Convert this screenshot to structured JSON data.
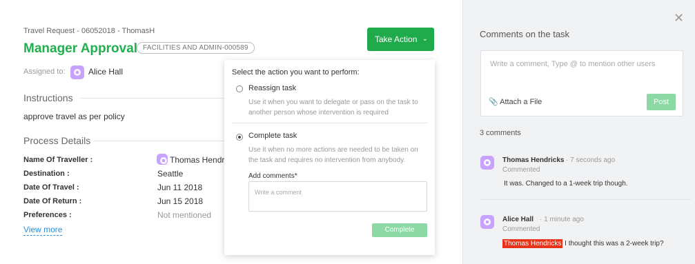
{
  "task": {
    "breadcrumb": "Travel Request - 06052018 - ThomasH",
    "title": "Manager Approval",
    "reference": "FACILITIES AND ADMIN-000589",
    "take_action_label": "Take Action",
    "assigned_label": "Assigned to:",
    "assignee": "Alice Hall"
  },
  "instructions": {
    "heading": "Instructions",
    "text": "approve travel as per policy"
  },
  "process_details": {
    "heading": "Process Details",
    "rows": [
      {
        "label": "Name Of Traveller :",
        "value": "Thomas Hendr"
      },
      {
        "label": "Destination :",
        "value": "Seattle"
      },
      {
        "label": "Date Of Travel :",
        "value": "Jun 11 2018"
      },
      {
        "label": "Date Of Return :",
        "value": "Jun 15 2018"
      },
      {
        "label": "Preferences :",
        "value": "Not mentioned"
      }
    ],
    "view_more": "View more"
  },
  "action_panel": {
    "title": "Select the action you want to perform:",
    "options": [
      {
        "label": "Reassign task",
        "description": "Use it when you want to delegate or pass on the task to another person whose intervention is required",
        "selected": false
      },
      {
        "label": "Complete task",
        "description": "Use it when no more actions are needed to be taken on the task and requires no intervention from anybody.",
        "selected": true
      }
    ],
    "comments_label": "Add comments*",
    "comments_placeholder": "Write a comment",
    "complete_label": "Complete"
  },
  "comments_panel": {
    "title": "Comments on the task",
    "input_placeholder": "Write a comment, Type @ to mention other users",
    "attach_label": "Attach a File",
    "post_label": "Post",
    "count_label": "3 comments",
    "comments": [
      {
        "author": "Thomas Hendricks",
        "time": "7 seconds ago",
        "action": "Commented",
        "mention": "",
        "text": "It was. Changed to a 1-week trip though."
      },
      {
        "author": "Alice Hall",
        "time": "1 minute ago",
        "action": "Commented",
        "mention": "Thomas Hendricks",
        "text": "I thought this was a 2-week trip?"
      }
    ]
  },
  "colors": {
    "accent_green": "#1faa4b",
    "title_green": "#22b04e",
    "disabled_green": "#8dd9a6",
    "link_blue": "#2b8fd6",
    "mention_red": "#e8321a",
    "avatar_purple": "#c7a2ff"
  }
}
